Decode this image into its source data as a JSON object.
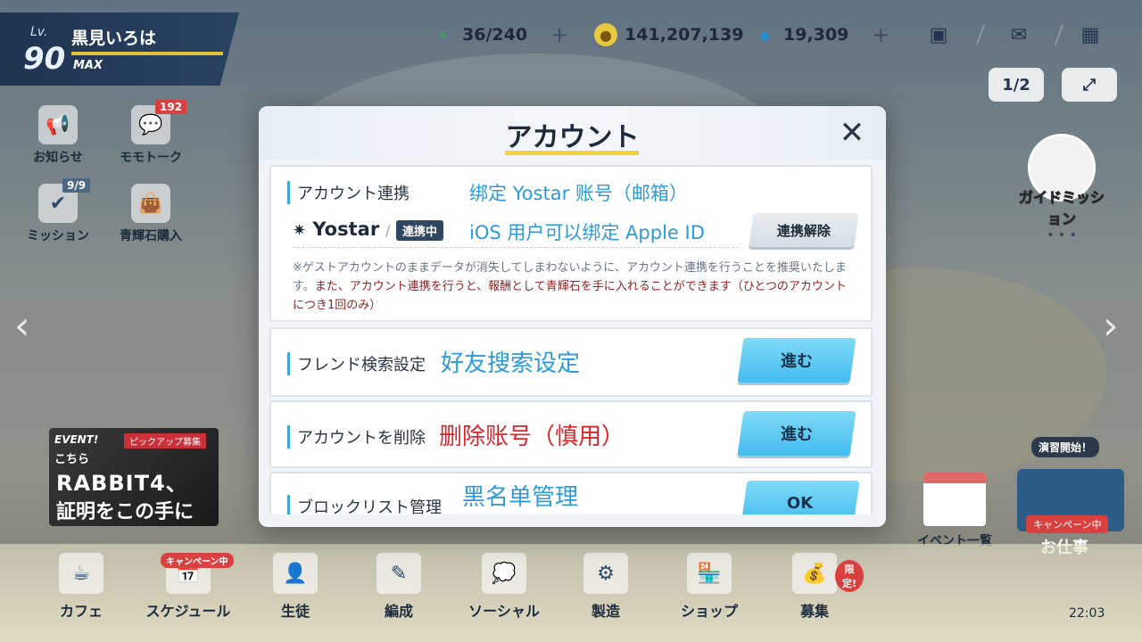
{
  "player": {
    "level_label": "Lv.",
    "level": "90",
    "name": "黒見いろは",
    "max": "MAX",
    "exp_fraction": 1.0
  },
  "resources": {
    "ap": "36/240",
    "credits": "141,207,139",
    "pyroxene": "19,309",
    "plus": "+"
  },
  "top_icons": [
    "group-icon",
    "mail-icon",
    "grid-menu-icon"
  ],
  "left_menu": {
    "notice": "お知らせ",
    "momotalk": "モモトーク",
    "momotalk_count": "192",
    "mission": "ミッション",
    "mission_count": "9/9",
    "pyroxene_shop": "青輝石購入"
  },
  "right_menu": {
    "page_toggle": "1/2",
    "guide_mission": "ガイドミッション"
  },
  "event_banner": {
    "tag": "EVENT!",
    "pickup": "ピックアップ募集",
    "line1": "こちら",
    "line2": "RABBIT4、",
    "line3": "証明をこの手に"
  },
  "event_list_label": "イベント一覧",
  "job": {
    "start": "演習開始！",
    "campaign": "キャンペーン中",
    "label": "お仕事"
  },
  "bottom_nav": [
    {
      "label": "カフェ"
    },
    {
      "label": "スケジュール",
      "campaign": "キャンペーン中"
    },
    {
      "label": "生徒"
    },
    {
      "label": "編成"
    },
    {
      "label": "ソーシャル"
    },
    {
      "label": "製造"
    },
    {
      "label": "ショップ"
    },
    {
      "label": "募集",
      "limited": "限定!"
    }
  ],
  "clock": "22:03",
  "modal": {
    "title": "アカウント",
    "account_link": {
      "label": "アカウント連携",
      "cn_hint": "绑定 Yostar 账号（邮箱）",
      "provider": "Yostar",
      "slash": "/",
      "status_badge": "連携中",
      "cn_hint2": "iOS 用户可以绑定 Apple ID",
      "unlink_button": "連携解除",
      "note1": "※ゲストアカウントのままデータが消失してしまわないように、アカウント連携を行うことを推奨いたします。",
      "note2": "また、アカウント連携を行うと、報酬として青輝石を手に入れることができます（ひとつのアカウントにつき1回のみ）"
    },
    "friend_search": {
      "label": "フレンド検索設定",
      "cn_hint": "好友搜索设定",
      "button": "進む"
    },
    "delete_account": {
      "label": "アカウントを削除",
      "cn_hint": "删除账号（慎用）",
      "button": "進む"
    },
    "block_list": {
      "label": "ブロックリスト管理",
      "cn_hint": "黑名单管理",
      "button": "OK"
    }
  }
}
